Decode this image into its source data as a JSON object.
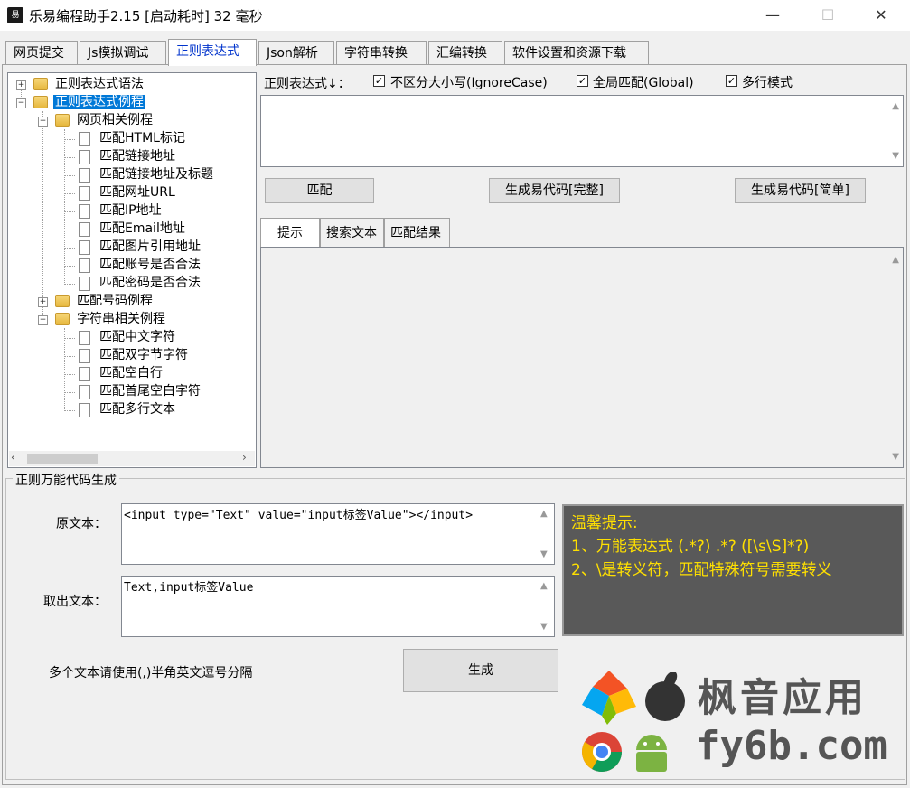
{
  "window": {
    "title": "乐易编程助手2.15 [启动耗时] 32 毫秒",
    "icon_text": "易",
    "controls": {
      "minimize": "—",
      "maximize": "☐",
      "close": "✕"
    }
  },
  "tabs": [
    {
      "label": "网页提交"
    },
    {
      "label": "Js模拟调试"
    },
    {
      "label": "正则表达式"
    },
    {
      "label": "Json解析"
    },
    {
      "label": "字符串转换"
    },
    {
      "label": "汇编转换"
    },
    {
      "label": "软件设置和资源下载"
    }
  ],
  "tree": {
    "root1": "正则表达式语法",
    "root2": "正则表达式例程",
    "group_web": "网页相关例程",
    "web_items": [
      "匹配HTML标记",
      "匹配链接地址",
      "匹配链接地址及标题",
      "匹配网址URL",
      "匹配IP地址",
      "匹配Email地址",
      "匹配图片引用地址",
      "匹配账号是否合法",
      "匹配密码是否合法"
    ],
    "group_number": "匹配号码例程",
    "group_string": "字符串相关例程",
    "string_items": [
      "匹配中文字符",
      "匹配双字节字符",
      "匹配空白行",
      "匹配首尾空白字符",
      "匹配多行文本"
    ]
  },
  "regex": {
    "label": "正则表达式↓：",
    "opt_ignorecase": "不区分大小写(IgnoreCase)",
    "opt_global": "全局匹配(Global)",
    "opt_multiline": "多行模式",
    "match_button": "匹配",
    "gen_full_button": "生成易代码[完整]",
    "gen_simple_button": "生成易代码[简单]",
    "inner_tabs": [
      "提示",
      "搜索文本",
      "匹配结果"
    ]
  },
  "universal": {
    "group_title": "正则万能代码生成",
    "source_label": "原文本：",
    "source_value": "<input type=\"Text\" value=\"input标签Value\"></input>",
    "extract_label": "取出文本：",
    "extract_value": "Text,input标签Value",
    "hint": "多个文本请使用(,)半角英文逗号分隔",
    "generate_button": "生成"
  },
  "tips": {
    "title": "温馨提示:",
    "line1": "1、万能表达式 (.*?) .*?  ([\\s\\S]*?)",
    "line2": "2、\\是转义符，匹配特殊符号需要转义"
  },
  "watermark": {
    "brand": "枫音应用",
    "domain": "fy6b.com"
  }
}
